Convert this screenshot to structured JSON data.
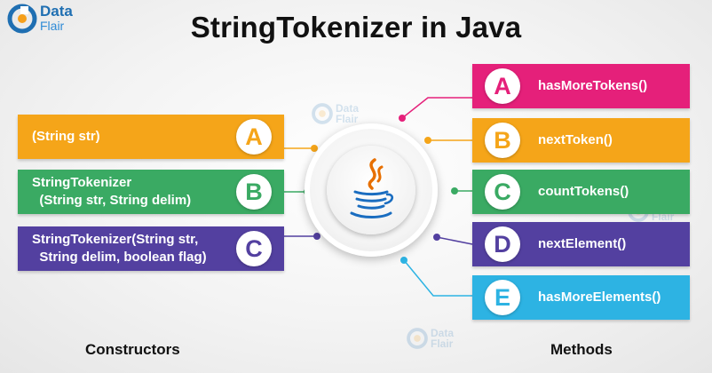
{
  "logo": {
    "line1": "Data",
    "line2": "Flair"
  },
  "title": "StringTokenizer in Java",
  "constructors": {
    "label": "Constructors",
    "items": [
      {
        "letter": "A",
        "text": "(String str)",
        "color": "#f5a519"
      },
      {
        "letter": "B",
        "text": "StringTokenizer\n  (String str, String delim)",
        "color": "#3aaa63"
      },
      {
        "letter": "C",
        "text": "StringTokenizer(String str,\n  String delim, boolean flag)",
        "color": "#5340a0"
      }
    ]
  },
  "methods": {
    "label": "Methods",
    "items": [
      {
        "letter": "A",
        "text": "hasMoreTokens()",
        "color": "#e5207a"
      },
      {
        "letter": "B",
        "text": "nextToken()",
        "color": "#f5a519"
      },
      {
        "letter": "C",
        "text": "countTokens()",
        "color": "#3aaa63"
      },
      {
        "letter": "D",
        "text": "nextElement()",
        "color": "#5340a0"
      },
      {
        "letter": "E",
        "text": "hasMoreElements()",
        "color": "#2db3e3"
      }
    ]
  },
  "watermark": {
    "line1": "Data",
    "line2": "Flair"
  },
  "center_icon": "java-cup-icon"
}
